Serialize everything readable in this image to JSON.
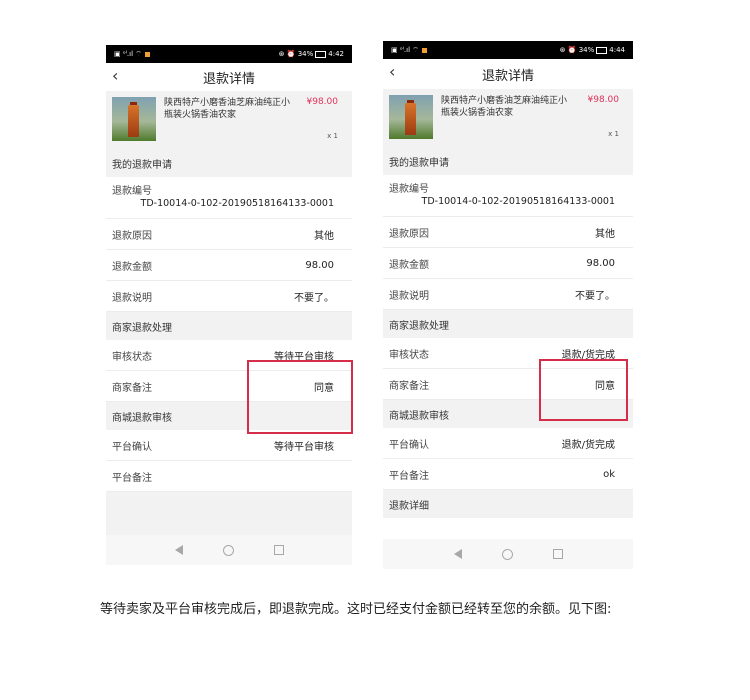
{
  "caption": "等待卖家及平台审核完成后，即退款完成。这时已经支付金额已经转至您的余额。见下图:",
  "phones": [
    {
      "status": {
        "left_icons": "▣ ᵒˡ.ıl ⌔",
        "right_text": "⊛ ⏰ 34%",
        "time": "4:42"
      },
      "title": "退款详情",
      "product": {
        "name": "陕西特产小磨香油芝麻油纯正小瓶装火锅香油农家",
        "price": "¥98.00",
        "qty": "x 1"
      },
      "sections": {
        "my_request": "我的退款申请",
        "merchant": "商家退款处理",
        "platform": "商城退款审核"
      },
      "refund_no_label": "退款编号",
      "refund_no": "TD-10014-0-102-20190518164133-0001",
      "reason_label": "退款原因",
      "reason": "其他",
      "amount_label": "退款金额",
      "amount": "98.00",
      "note_label": "退款说明",
      "note": "不要了。",
      "audit_label": "审核状态",
      "audit": "等待平台审核",
      "merchant_note_label": "商家备注",
      "merchant_note": "同意",
      "platform_confirm_label": "平台确认",
      "platform_confirm": "等待平台审核",
      "platform_note_label": "平台备注",
      "platform_note": ""
    },
    {
      "status": {
        "left_icons": "▣ ᵒˡ.ıl ⌔",
        "right_text": "⊛ ⏰ 34%",
        "time": "4:44"
      },
      "title": "退款详情",
      "product": {
        "name": "陕西特产小磨香油芝麻油纯正小瓶装火锅香油农家",
        "price": "¥98.00",
        "qty": "x 1"
      },
      "sections": {
        "my_request": "我的退款申请",
        "merchant": "商家退款处理",
        "platform": "商城退款审核",
        "detail": "退款详细"
      },
      "refund_no_label": "退款编号",
      "refund_no": "TD-10014-0-102-20190518164133-0001",
      "reason_label": "退款原因",
      "reason": "其他",
      "amount_label": "退款金额",
      "amount": "98.00",
      "note_label": "退款说明",
      "note": "不要了。",
      "audit_label": "审核状态",
      "audit": "退款/货完成",
      "merchant_note_label": "商家备注",
      "merchant_note": "同意",
      "platform_confirm_label": "平台确认",
      "platform_confirm": "退款/货完成",
      "platform_note_label": "平台备注",
      "platform_note": "ok"
    }
  ],
  "colors": {
    "highlight": "#d62d4a",
    "price": "#e0335a",
    "section_bg": "#f2f2f2"
  }
}
